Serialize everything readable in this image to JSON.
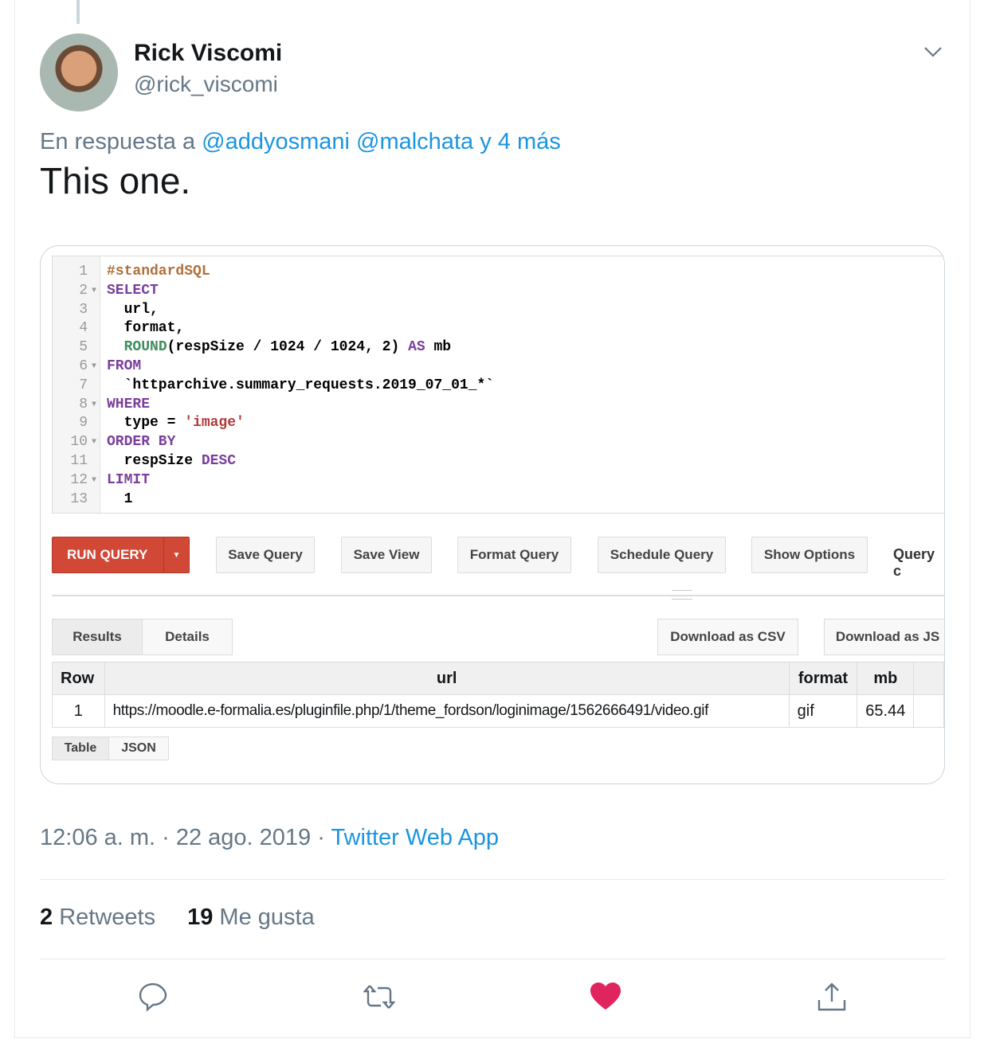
{
  "tweet": {
    "name": "Rick Viscomi",
    "handle": "@rick_viscomi",
    "reply_prefix": "En respuesta a",
    "reply_users": [
      "@addyosmani",
      "@malchata"
    ],
    "reply_more": "y 4 más",
    "text": "This one.",
    "timestamp": "12:06 a. m. · 22 ago. 2019 · ",
    "source": "Twitter Web App",
    "retweets_count": "2",
    "retweets_label": "Retweets",
    "likes_count": "19",
    "likes_label": "Me gusta",
    "liked": true,
    "accent": "#1b95e0",
    "like_color": "#e0245e"
  },
  "screenshot": {
    "code": [
      {
        "n": "1",
        "f": false,
        "tokens": [
          {
            "t": "#standardSQL",
            "c": "comment"
          }
        ]
      },
      {
        "n": "2",
        "f": true,
        "tokens": [
          {
            "t": "SELECT",
            "c": "kw"
          }
        ]
      },
      {
        "n": "3",
        "f": false,
        "tokens": [
          {
            "t": "  url,",
            "c": "plain"
          }
        ]
      },
      {
        "n": "4",
        "f": false,
        "tokens": [
          {
            "t": "  format,",
            "c": "plain"
          }
        ]
      },
      {
        "n": "5",
        "f": false,
        "tokens": [
          {
            "t": "  ",
            "c": "plain"
          },
          {
            "t": "ROUND",
            "c": "fn"
          },
          {
            "t": "(respSize / 1024 / 1024, 2) ",
            "c": "plain"
          },
          {
            "t": "AS",
            "c": "kw"
          },
          {
            "t": " mb",
            "c": "plain"
          }
        ]
      },
      {
        "n": "6",
        "f": true,
        "tokens": [
          {
            "t": "FROM",
            "c": "kw"
          }
        ]
      },
      {
        "n": "7",
        "f": false,
        "tokens": [
          {
            "t": "  `httparchive.summary_requests.2019_07_01_*`",
            "c": "plain"
          }
        ]
      },
      {
        "n": "8",
        "f": true,
        "tokens": [
          {
            "t": "WHERE",
            "c": "kw"
          }
        ]
      },
      {
        "n": "9",
        "f": false,
        "tokens": [
          {
            "t": "  type = ",
            "c": "plain"
          },
          {
            "t": "'image'",
            "c": "str"
          }
        ]
      },
      {
        "n": "10",
        "f": true,
        "tokens": [
          {
            "t": "ORDER BY",
            "c": "kw"
          }
        ]
      },
      {
        "n": "11",
        "f": false,
        "tokens": [
          {
            "t": "  respSize ",
            "c": "plain"
          },
          {
            "t": "DESC",
            "c": "kw"
          }
        ]
      },
      {
        "n": "12",
        "f": true,
        "tokens": [
          {
            "t": "LIMIT",
            "c": "kw"
          }
        ]
      },
      {
        "n": "13",
        "f": false,
        "tokens": [
          {
            "t": "  1",
            "c": "plain"
          }
        ]
      }
    ],
    "buttons": {
      "run": "RUN QUERY",
      "save_query": "Save Query",
      "save_view": "Save View",
      "format_query": "Format Query",
      "schedule_query": "Schedule Query",
      "show_options": "Show Options",
      "query_cut": "Query c"
    },
    "tabs": {
      "results": "Results",
      "details": "Details",
      "csv": "Download as CSV",
      "json_dl": "Download as JS"
    },
    "table": {
      "headers": [
        "Row",
        "url",
        "format",
        "mb"
      ],
      "row": [
        "1",
        "https://moodle.e-formalia.es/pluginfile.php/1/theme_fordson/loginimage/1562666491/video.gif",
        "gif",
        "65.44"
      ]
    },
    "view": {
      "table": "Table",
      "json": "JSON"
    }
  }
}
